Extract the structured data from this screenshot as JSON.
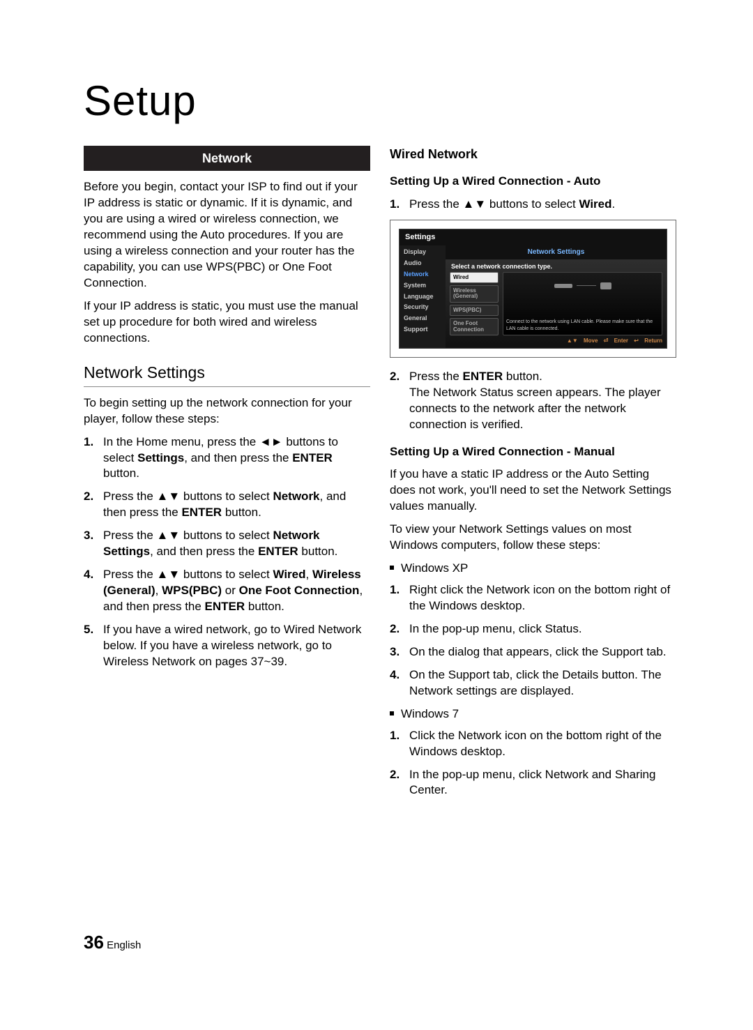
{
  "title": "Setup",
  "left": {
    "section_bar": "Network",
    "intro_1": "Before you begin, contact your ISP to find out if your IP address is static or dynamic. If it is dynamic, and you are using a wired or wireless connection, we recommend using the Auto procedures. If you are using a wireless connection and your router has the capability, you can use WPS(PBC) or One Foot Connection.",
    "intro_2": "If your IP address is static, you must use the manual set up procedure for both wired and wireless connections.",
    "h2": "Network Settings",
    "h2_sub": "To begin setting up the network connection for your player, follow these steps:",
    "steps": [
      "In the Home menu, press the ◄► buttons to select <b>Settings</b>, and then press the <b>ENTER</b> button.",
      "Press the ▲▼ buttons to select <b>Network</b>, and then press the <b>ENTER</b> button.",
      "Press the ▲▼ buttons to select <b>Network Settings</b>, and then press the <b>ENTER</b> button.",
      "Press the ▲▼ buttons to select <b>Wired</b>, <b>Wireless (General)</b>, <b>WPS(PBC)</b> or <b>One Foot Connection</b>, and then press the <b>ENTER</b> button.",
      "If you have a wired network, go to Wired Network below. If you have a wireless network, go to Wireless Network on pages 37~39."
    ]
  },
  "right": {
    "h3": "Wired Network",
    "h4a": "Setting Up a Wired Connection - Auto",
    "step_a1": "Press the ▲▼ buttons to select <b>Wired</b>.",
    "screenshot": {
      "window": "Settings",
      "side": [
        "Display",
        "Audio",
        "Network",
        "System",
        "Language",
        "Security",
        "General",
        "Support"
      ],
      "side_active_index": 2,
      "main_title": "Network Settings",
      "subtitle": "Select a network connection type.",
      "options": [
        "Wired",
        "Wireless (General)",
        "WPS(PBC)",
        "One Foot Connection"
      ],
      "selected_index": 0,
      "help": "Connect to the network using LAN cable. Please make sure that the LAN cable is connected.",
      "hints": [
        "> Move",
        "  Enter",
        "  Return"
      ],
      "hint_move": "Move",
      "hint_enter": "Enter",
      "hint_return": "Return"
    },
    "step_a2": "Press the <b>ENTER</b> button.\nThe Network Status screen appears. The player connects to the network after the network connection is verified.",
    "h4b": "Setting Up a Wired Connection - Manual",
    "manual_p1": "If you have a static IP address or the Auto Setting does not work, you'll need to set the Network Settings values manually.",
    "manual_p2": "To view your Network Settings values on most Windows computers, follow these steps:",
    "bullet_xp": "Windows XP",
    "xp_steps": [
      "Right click the Network icon on the bottom right of the Windows desktop.",
      "In the pop-up menu, click Status.",
      "On the dialog that appears, click the Support tab.",
      "On the Support tab, click the Details button. The Network settings are displayed."
    ],
    "bullet_7": "Windows 7",
    "w7_steps": [
      "Click the Network icon on the bottom right of the Windows desktop.",
      "In the pop-up menu, click Network and Sharing Center."
    ]
  },
  "footer": {
    "page": "36",
    "lang": "English"
  }
}
